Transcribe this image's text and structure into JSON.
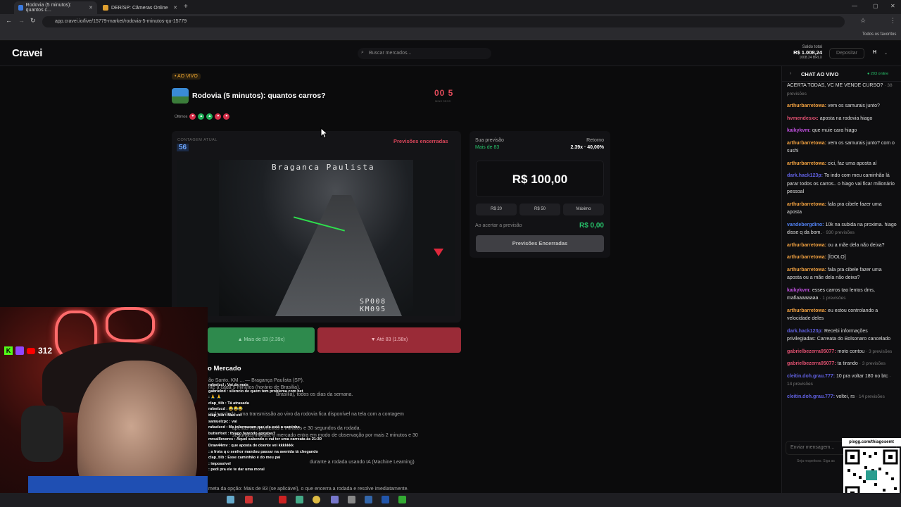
{
  "browser": {
    "tabs": [
      {
        "label": "Rodovia (5 minutos): quantos c...",
        "active": true
      },
      {
        "label": "DER/SP: Câmeras Online",
        "active": false
      }
    ],
    "url": "app.cravei.io/live/15779-market/rodovia-5-minutos-qu-15779",
    "bookmarks_label": "Todos os favoritos"
  },
  "header": {
    "logo": "Cravei",
    "search_placeholder": "Buscar mercados...",
    "balance_label": "Saldo total",
    "balance_value": "R$ 1.008,24",
    "balance_sub": "1008.24 BRLX",
    "deposit_label": "Depositar",
    "user_initial": "H"
  },
  "market": {
    "live_tag": "• AO VIVO",
    "title": "Rodovia (5 minutos): quantos carros?",
    "timer": "00 5",
    "timer_labels": "MINS   SEGS",
    "ultimos_label": "Últimos",
    "last_results": [
      "r",
      "g",
      "g",
      "r",
      "r"
    ],
    "count_label": "CONTAGEM ATUAL",
    "count_value": "56",
    "status": "Previsões encerradas",
    "camera_top": "Braganca Paulista",
    "camera_bottom": "SP008 KM095",
    "btn_up": "Mais de 83 (2.39x)",
    "btn_down": "Até 83 (1.58x)",
    "about_title": "o Mercado",
    "about_lines": [
      "ão Santo, KM ... — Bragança Paulista (SP).",
      "nte a cada 5 minutos (horário de Brasília).",
      "Brasília), todos os dias da semana.",
      "cada rodada, uma transmissão ao vivo da rodovia fica disponível na tela com a contagem",
      "apenas nos primeiros 2 minutos e 30 segundos da rodada.",
      "segundos iniciais, o mercado entra em modo de observação por mais 2 minutos e 30",
      "durante a rodada usando IA (Machine Learning)",
      "meta da opção: Mais de 83 (se aplicável), o que encerra a rodada e resolve imediatamente."
    ]
  },
  "bet": {
    "sua_previsao": "Sua previsão",
    "sua_previsao_value": "Mais de 83",
    "retorno": "Retorno",
    "retorno_value": "2.39x · 40,00%",
    "amount": "R$ 100,00",
    "quick": [
      "R$ 20",
      "R$ 50",
      "Máximo"
    ],
    "ao_acertar": "Ao acertar a previsão",
    "ao_acertar_value": "R$ 0,00",
    "button": "Previsões Encerradas"
  },
  "chat": {
    "title": "CHAT AO VIVO",
    "online": "● 203 online",
    "input_placeholder": "Enviar mensagem...",
    "note": "Seja respeitoso. Siga as",
    "messages": [
      {
        "user": "",
        "color": "#ddd",
        "text": "ACERTA TODAS, VC ME VENDE CURSO?",
        "sub": "· 38 previsões"
      },
      {
        "user": "arthurbarretowa:",
        "color": "#f0a040",
        "text": "vem os samurais junto?",
        "sub": ""
      },
      {
        "user": "hvmendesxx:",
        "color": "#e05070",
        "text": "aposta na rodovia hiago",
        "sub": ""
      },
      {
        "user": "kaikykvm:",
        "color": "#c050e0",
        "text": "que muie cara hiago",
        "sub": ""
      },
      {
        "user": "arthurbarretowa:",
        "color": "#f0a040",
        "text": "vem os samurais junto? com o sushi",
        "sub": ""
      },
      {
        "user": "arthurbarretowa:",
        "color": "#f0a040",
        "text": "cici, faz uma aposta aí",
        "sub": ""
      },
      {
        "user": "dark.hack123p:",
        "color": "#6060e0",
        "text": "To indo com meu caminhão lá parar todos os carros.. o hiago vai ficar milionário pessoal",
        "sub": ""
      },
      {
        "user": "arthurbarretowa:",
        "color": "#f0a040",
        "text": "fala pra cibele fazer uma aposta",
        "sub": ""
      },
      {
        "user": "vandebergdino:",
        "color": "#5080f0",
        "text": "10k na subida na proxima. hiago disse q da bom.",
        "sub": "· 930 previsões"
      },
      {
        "user": "arthurbarretowa:",
        "color": "#f0a040",
        "text": "ou a mãe dela não deixa?",
        "sub": ""
      },
      {
        "user": "arthurbarretowa:",
        "color": "#f0a040",
        "text": "[ÍDOLO]",
        "sub": ""
      },
      {
        "user": "arthurbarretowa:",
        "color": "#f0a040",
        "text": "fala pra cibele fazer uma aposta ou a mãe dela não deixa?",
        "sub": ""
      },
      {
        "user": "kaikykvm:",
        "color": "#c050e0",
        "text": "esses carros tao lentos dms, mafiaaaaaaaa",
        "sub": "· 1 previsões"
      },
      {
        "user": "arthurbarretowa:",
        "color": "#f0a040",
        "text": "eu estou controlando a velocidade deles",
        "sub": ""
      },
      {
        "user": "dark.hack123p:",
        "color": "#6060e0",
        "text": "Recebi informações privilegiadas: Carreata do Bolsonaro cancelado",
        "sub": ""
      },
      {
        "user": "gabrielbezerra05077:",
        "color": "#e05070",
        "text": "moto contou",
        "sub": "· 3 previsões"
      },
      {
        "user": "gabrielbezerra05077:",
        "color": "#e05070",
        "text": "ta tirando",
        "sub": "· 3 previsões"
      },
      {
        "user": "cleitin.doh.grau.777:",
        "color": "#6060e0",
        "text": "10 pra voltar 180 no btc",
        "sub": "· 14 previsões"
      },
      {
        "user": "cleitin.doh.grau.777:",
        "color": "#6060e0",
        "text": "voltei, rs",
        "sub": "· 14 previsões"
      }
    ]
  },
  "overlay": {
    "viewers": "312",
    "qr_label": "pixgg.com/thiagosemt",
    "stream_chat": [
      "rafaelzcl : Vai da mais",
      "gabrielnd : silencio de quem tem problema com bet",
      ": 🙏 🙏",
      "clap_tiib : Tá atrasada",
      "rafaelzcd : 😂😂😂",
      "clap_tiib : Mas vei",
      "samuelzpc : vai",
      "rafaelzcd : Me informaram que ele está a caminho",
      "butterfoot : thiago fazendo apostas?",
      "mrsallleveres : Aquel sabendo o vai ter uma carreata às 21:30",
      "Draw44mv : que aposta de doente vei kkkkkkk",
      ": a frota q o senhor mandou passar na avenida tá chegando",
      "clap_tiib : Esse caminhão é do meu pai",
      ": impossivel",
      ": pedi pra ele te dar uma moral"
    ]
  }
}
